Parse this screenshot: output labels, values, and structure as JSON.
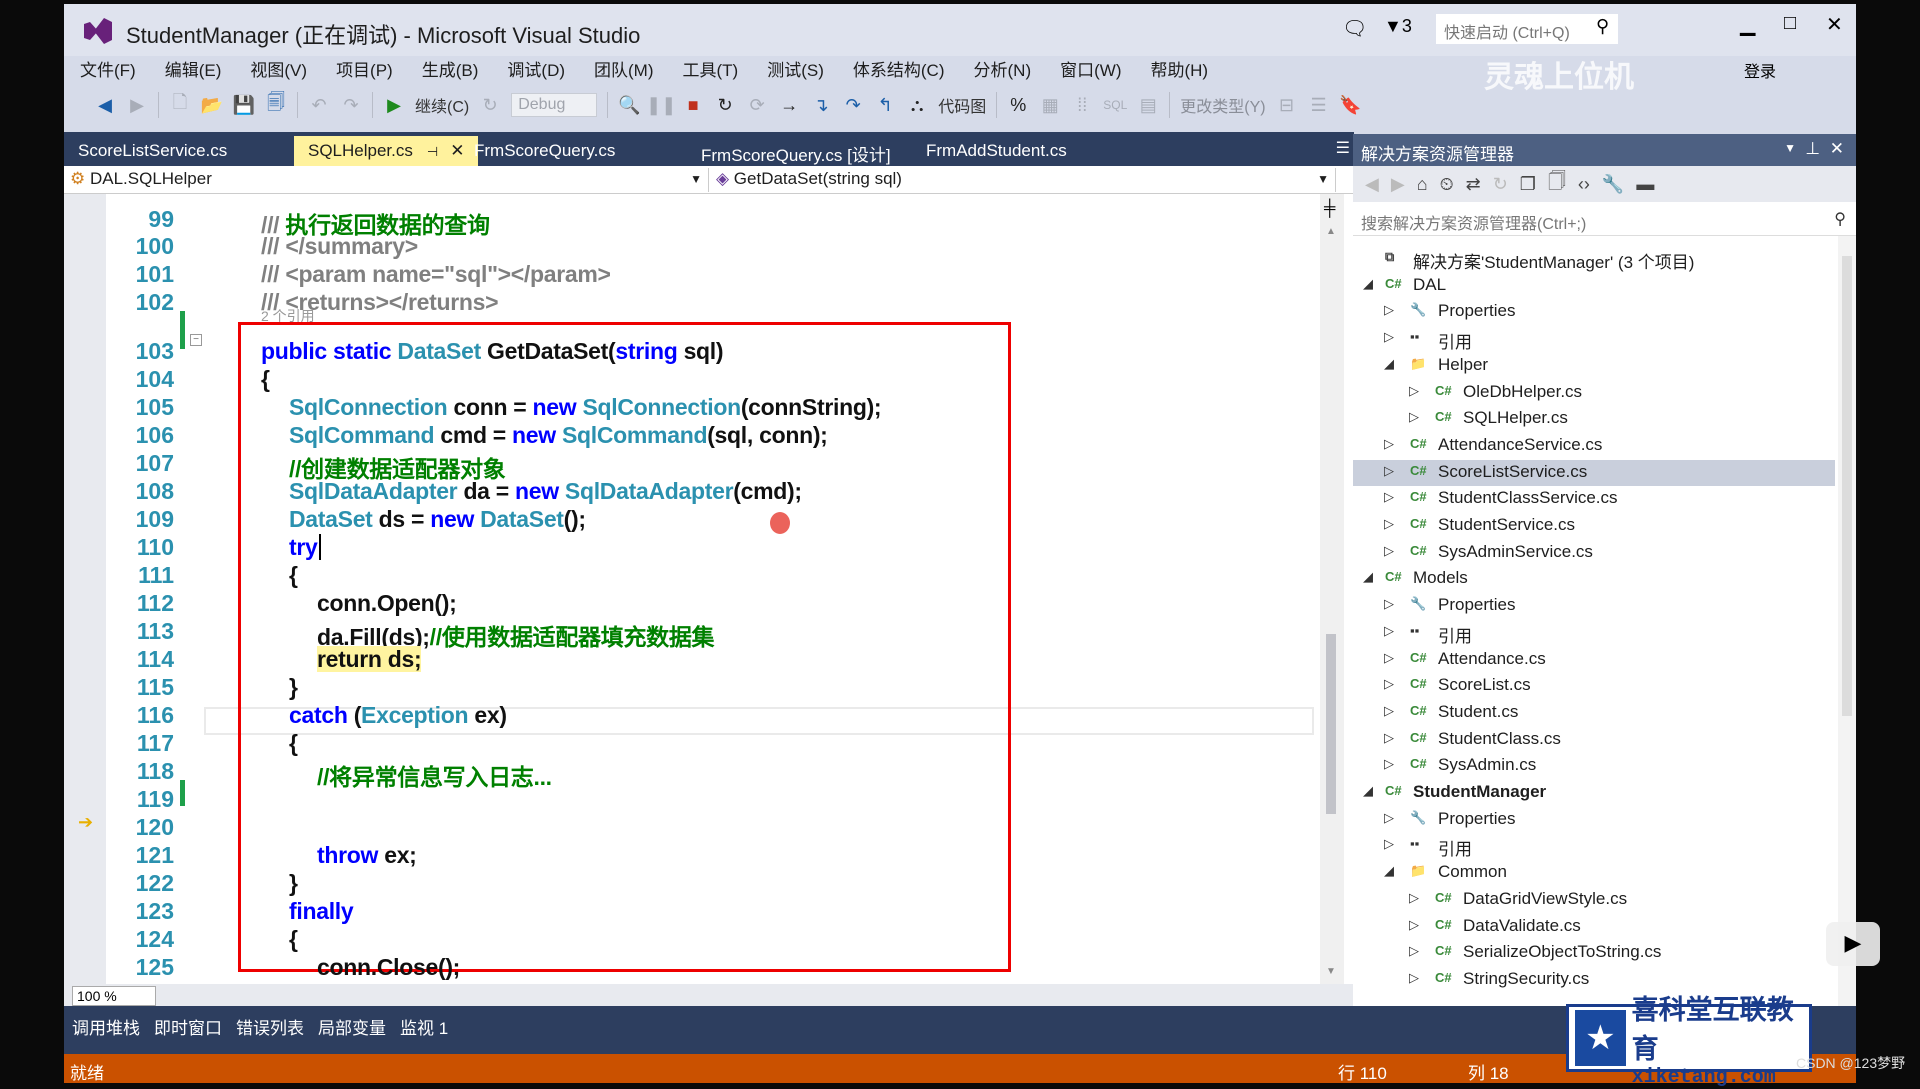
{
  "window": {
    "title": "StudentManager (正在调试) - Microsoft Visual Studio",
    "notifications": "3",
    "quick_launch_placeholder": "快速启动 (Ctrl+Q)",
    "sign_in": "登录"
  },
  "menu": [
    "文件(F)",
    "编辑(E)",
    "视图(V)",
    "项目(P)",
    "生成(B)",
    "调试(D)",
    "团队(M)",
    "工具(T)",
    "测试(S)",
    "体系结构(C)",
    "分析(N)",
    "窗口(W)",
    "帮助(H)"
  ],
  "toolbar": {
    "continue": "继续(C)",
    "config": "Debug",
    "code_map": "代码图",
    "change_type": "更改类型(Y)",
    "sql": "SQL"
  },
  "tabs": [
    {
      "label": "ScoreListService.cs",
      "active": false
    },
    {
      "label": "SQLHelper.cs",
      "active": true
    },
    {
      "label": "FrmScoreQuery.cs",
      "active": false
    },
    {
      "label": "FrmScoreQuery.cs [设计]",
      "active": false
    },
    {
      "label": "FrmAddStudent.cs",
      "active": false
    }
  ],
  "nav": {
    "class": "DAL.SQLHelper",
    "member": "GetDataSet(string sql)"
  },
  "codelens": "2 个引用",
  "code": [
    {
      "n": "99",
      "indent": 0,
      "tokens": [
        [
          "dc",
          "/// "
        ],
        [
          "cm",
          "执行返回数据的查询"
        ]
      ]
    },
    {
      "n": "100",
      "indent": 0,
      "tokens": [
        [
          "dc",
          "/// </summary>"
        ]
      ]
    },
    {
      "n": "101",
      "indent": 0,
      "tokens": [
        [
          "dc",
          "/// <param name=\"sql\"></param>"
        ]
      ]
    },
    {
      "n": "102",
      "indent": 0,
      "tokens": [
        [
          "dc",
          "/// <returns></returns>"
        ]
      ]
    },
    {
      "n": "103",
      "indent": 0,
      "tokens": [
        [
          "kw",
          "public static "
        ],
        [
          "ty",
          "DataSet "
        ],
        [
          "pl",
          "GetDataSet("
        ],
        [
          "kw",
          "string "
        ],
        [
          "pl",
          "sql)"
        ]
      ]
    },
    {
      "n": "104",
      "indent": 0,
      "tokens": [
        [
          "pl",
          "{"
        ]
      ]
    },
    {
      "n": "105",
      "indent": 1,
      "tokens": [
        [
          "ty",
          "SqlConnection "
        ],
        [
          "pl",
          "conn = "
        ],
        [
          "kw",
          "new "
        ],
        [
          "ty",
          "SqlConnection"
        ],
        [
          "pl",
          "(connString);"
        ]
      ]
    },
    {
      "n": "106",
      "indent": 1,
      "tokens": [
        [
          "ty",
          "SqlCommand "
        ],
        [
          "pl",
          "cmd = "
        ],
        [
          "kw",
          "new "
        ],
        [
          "ty",
          "SqlCommand"
        ],
        [
          "pl",
          "(sql, conn);"
        ]
      ]
    },
    {
      "n": "107",
      "indent": 1,
      "tokens": [
        [
          "cm",
          "//创建数据适配器对象"
        ]
      ]
    },
    {
      "n": "108",
      "indent": 1,
      "tokens": [
        [
          "ty",
          "SqlDataAdapter "
        ],
        [
          "pl",
          "da = "
        ],
        [
          "kw",
          "new "
        ],
        [
          "ty",
          "SqlDataAdapter"
        ],
        [
          "pl",
          "(cmd);"
        ]
      ]
    },
    {
      "n": "109",
      "indent": 1,
      "tokens": [
        [
          "ty",
          "DataSet "
        ],
        [
          "pl",
          "ds = "
        ],
        [
          "kw",
          "new "
        ],
        [
          "ty",
          "DataSet"
        ],
        [
          "pl",
          "();"
        ]
      ]
    },
    {
      "n": "110",
      "indent": 1,
      "tokens": [
        [
          "kw",
          "try"
        ]
      ]
    },
    {
      "n": "111",
      "indent": 1,
      "tokens": [
        [
          "pl",
          "{"
        ]
      ]
    },
    {
      "n": "112",
      "indent": 2,
      "tokens": [
        [
          "pl",
          "conn.Open();"
        ]
      ]
    },
    {
      "n": "113",
      "indent": 2,
      "tokens": [
        [
          "pl",
          "da.Fill(ds);"
        ],
        [
          "cm",
          "//使用数据适配器填充数据集"
        ]
      ]
    },
    {
      "n": "114",
      "indent": 2,
      "tokens": [
        [
          "hl",
          "return ds;"
        ]
      ]
    },
    {
      "n": "115",
      "indent": 1,
      "tokens": [
        [
          "pl",
          "}"
        ]
      ]
    },
    {
      "n": "116",
      "indent": 1,
      "tokens": [
        [
          "kw",
          "catch "
        ],
        [
          "pl",
          "("
        ],
        [
          "ty",
          "Exception "
        ],
        [
          "pl",
          "ex)"
        ]
      ]
    },
    {
      "n": "117",
      "indent": 1,
      "tokens": [
        [
          "pl",
          "{"
        ]
      ]
    },
    {
      "n": "118",
      "indent": 2,
      "tokens": [
        [
          "cm",
          "//将异常信息写入日志..."
        ]
      ]
    },
    {
      "n": "119",
      "indent": 2,
      "tokens": []
    },
    {
      "n": "120",
      "indent": 2,
      "tokens": []
    },
    {
      "n": "121",
      "indent": 2,
      "tokens": [
        [
          "kw",
          "throw "
        ],
        [
          "pl",
          "ex;"
        ]
      ]
    },
    {
      "n": "122",
      "indent": 1,
      "tokens": [
        [
          "pl",
          "}"
        ]
      ]
    },
    {
      "n": "123",
      "indent": 1,
      "tokens": [
        [
          "kw",
          "finally"
        ]
      ]
    },
    {
      "n": "124",
      "indent": 1,
      "tokens": [
        [
          "pl",
          "{"
        ]
      ]
    },
    {
      "n": "125",
      "indent": 2,
      "tokens": [
        [
          "pl",
          "conn.Close();"
        ]
      ]
    }
  ],
  "editor": {
    "zoom": "100 %"
  },
  "bottom_tabs": [
    "调用堆栈",
    "即时窗口",
    "错误列表",
    "局部变量",
    "监视 1"
  ],
  "status": {
    "text": "就绪",
    "line": "行 110",
    "col": "列 18"
  },
  "solution_explorer": {
    "title": "解决方案资源管理器",
    "search_placeholder": "搜索解决方案资源管理器(Ctrl+;)",
    "items": [
      {
        "label": "解决方案'StudentManager' (3 个项目)",
        "level": 0,
        "icon": "solution",
        "exp": ""
      },
      {
        "label": "DAL",
        "level": 0,
        "icon": "csproj",
        "exp": "open"
      },
      {
        "label": "Properties",
        "level": 1,
        "icon": "wrench",
        "exp": "closed"
      },
      {
        "label": "引用",
        "level": 1,
        "icon": "references",
        "exp": "closed"
      },
      {
        "label": "Helper",
        "level": 1,
        "icon": "folder",
        "exp": "open"
      },
      {
        "label": "OleDbHelper.cs",
        "level": 2,
        "icon": "cs",
        "exp": "closed"
      },
      {
        "label": "SQLHelper.cs",
        "level": 2,
        "icon": "cs",
        "exp": "closed"
      },
      {
        "label": "AttendanceService.cs",
        "level": 1,
        "icon": "cs",
        "exp": "closed"
      },
      {
        "label": "ScoreListService.cs",
        "level": 1,
        "icon": "cs",
        "exp": "closed",
        "selected": true
      },
      {
        "label": "StudentClassService.cs",
        "level": 1,
        "icon": "cs",
        "exp": "closed"
      },
      {
        "label": "StudentService.cs",
        "level": 1,
        "icon": "cs",
        "exp": "closed"
      },
      {
        "label": "SysAdminService.cs",
        "level": 1,
        "icon": "cs",
        "exp": "closed"
      },
      {
        "label": "Models",
        "level": 0,
        "icon": "csproj",
        "exp": "open"
      },
      {
        "label": "Properties",
        "level": 1,
        "icon": "wrench",
        "exp": "closed"
      },
      {
        "label": "引用",
        "level": 1,
        "icon": "references",
        "exp": "closed"
      },
      {
        "label": "Attendance.cs",
        "level": 1,
        "icon": "cs",
        "exp": "closed"
      },
      {
        "label": "ScoreList.cs",
        "level": 1,
        "icon": "cs",
        "exp": "closed"
      },
      {
        "label": "Student.cs",
        "level": 1,
        "icon": "cs",
        "exp": "closed"
      },
      {
        "label": "StudentClass.cs",
        "level": 1,
        "icon": "cs",
        "exp": "closed"
      },
      {
        "label": "SysAdmin.cs",
        "level": 1,
        "icon": "cs",
        "exp": "closed"
      },
      {
        "label": "StudentManager",
        "level": 0,
        "icon": "csproj",
        "exp": "open",
        "bold": true
      },
      {
        "label": "Properties",
        "level": 1,
        "icon": "wrench",
        "exp": "closed"
      },
      {
        "label": "引用",
        "level": 1,
        "icon": "references",
        "exp": "closed"
      },
      {
        "label": "Common",
        "level": 1,
        "icon": "folder",
        "exp": "open"
      },
      {
        "label": "DataGridViewStyle.cs",
        "level": 2,
        "icon": "cs",
        "exp": "closed"
      },
      {
        "label": "DataValidate.cs",
        "level": 2,
        "icon": "cs",
        "exp": "closed"
      },
      {
        "label": "SerializeObjectToString.cs",
        "level": 2,
        "icon": "cs",
        "exp": "closed"
      },
      {
        "label": "StringSecurity.cs",
        "level": 2,
        "icon": "cs",
        "exp": "closed"
      }
    ]
  },
  "watermarks": {
    "bilibili": "灵魂上位机",
    "xiketang_cn": "喜科堂互联教育",
    "xiketang_url": "xiketang.com",
    "csdn": "CSDN @123梦野"
  },
  "colors": {
    "keyword": "#0000ff",
    "type": "#2b91af",
    "comment": "#008000",
    "status_bar": "#ca5100",
    "tab_strip": "#2d3e5f",
    "highlight_box": "#ee0000"
  }
}
